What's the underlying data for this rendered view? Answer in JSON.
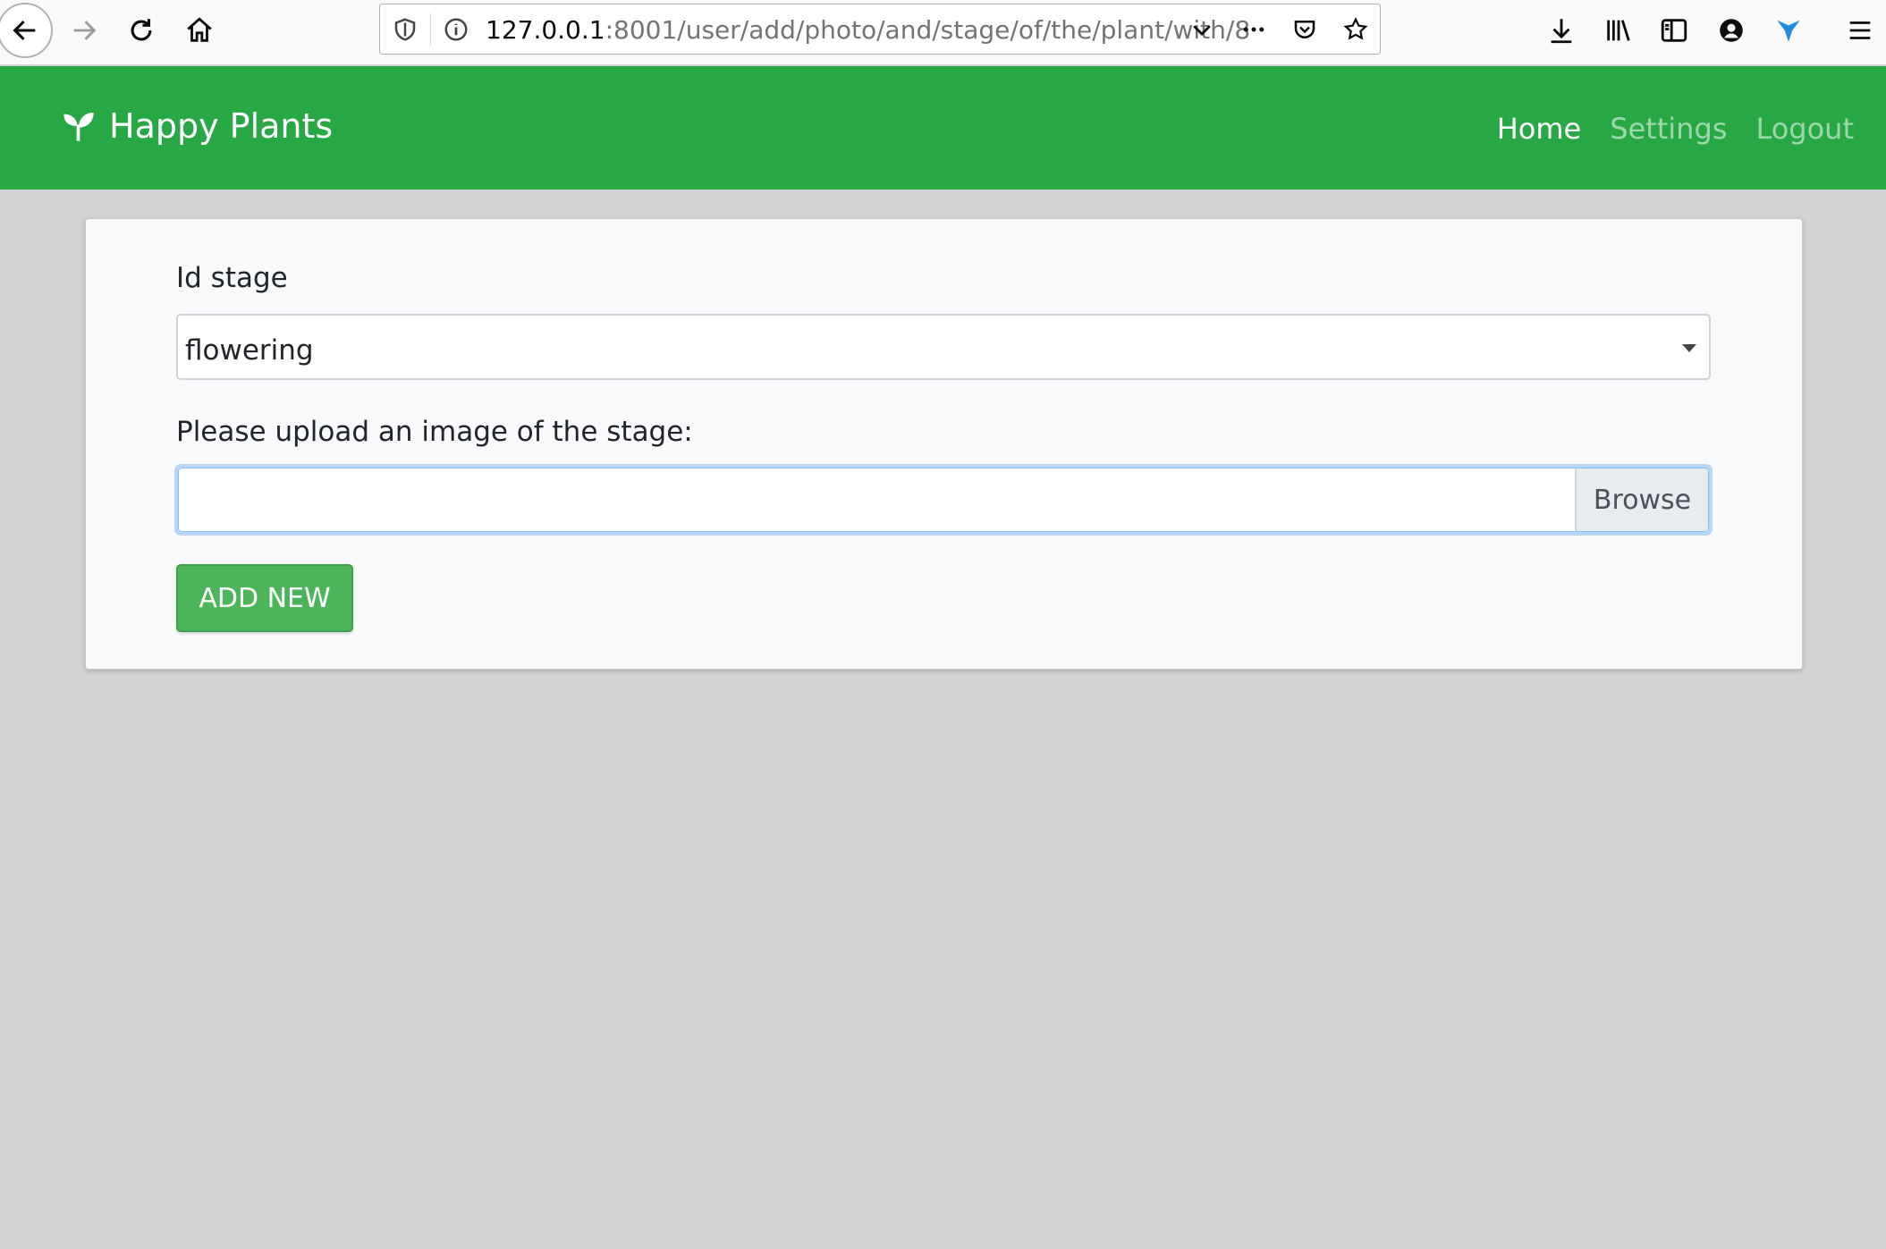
{
  "browser": {
    "url_host": "127.0.0.1",
    "url_path": ":8001/user/add/photo/and/stage/of/the/plant/with/8"
  },
  "navbar": {
    "brand": "Happy Plants",
    "links": [
      {
        "label": "Home",
        "active": true
      },
      {
        "label": "Settings",
        "active": false
      },
      {
        "label": "Logout",
        "active": false
      }
    ]
  },
  "form": {
    "stage_label": "Id stage",
    "stage_value": "flowering",
    "upload_label": "Please upload an image of the stage:",
    "browse_label": "Browse",
    "submit_label": "ADD NEW"
  },
  "colors": {
    "navbar": "#28a745",
    "button": "#4cb55a",
    "page_background": "#d3d3d3"
  }
}
